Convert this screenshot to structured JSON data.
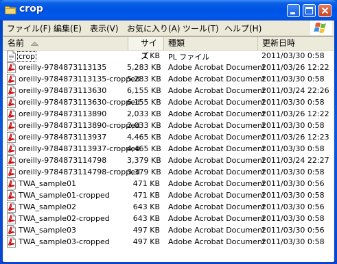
{
  "window": {
    "title": "crop"
  },
  "menu": [
    "ファイル(F)",
    "編集(E)",
    "表示(V)",
    "お気に入り(A)",
    "ツール(T)",
    "ヘルプ(H)"
  ],
  "columns": {
    "name": "名前",
    "size": "サイズ",
    "type": "種類",
    "date": "更新日時"
  },
  "files": [
    {
      "name": "crop",
      "size": "1 KB",
      "type": "PL ファイル",
      "date": "2011/03/30 0:58",
      "icon": "pl-file-icon"
    },
    {
      "name": "oreilly-9784873113135",
      "size": "5,283 KB",
      "type": "Adobe Acrobat Document",
      "date": "2011/03/26 12:22",
      "icon": "pdf-icon"
    },
    {
      "name": "oreilly-9784873113135-cropped",
      "size": "5,283 KB",
      "type": "Adobe Acrobat Document",
      "date": "2011/03/30 0:58",
      "icon": "pdf-icon"
    },
    {
      "name": "oreilly-9784873113630",
      "size": "6,155 KB",
      "type": "Adobe Acrobat Document",
      "date": "2011/03/24 22:26",
      "icon": "pdf-icon"
    },
    {
      "name": "oreilly-9784873113630-cropped",
      "size": "6,155 KB",
      "type": "Adobe Acrobat Document",
      "date": "2011/03/30 0:58",
      "icon": "pdf-icon"
    },
    {
      "name": "oreilly-9784873113890",
      "size": "2,033 KB",
      "type": "Adobe Acrobat Document",
      "date": "2011/03/26 12:22",
      "icon": "pdf-icon"
    },
    {
      "name": "oreilly-9784873113890-cropped",
      "size": "2,033 KB",
      "type": "Adobe Acrobat Document",
      "date": "2011/03/30 0:58",
      "icon": "pdf-icon"
    },
    {
      "name": "oreilly-9784873113937",
      "size": "4,465 KB",
      "type": "Adobe Acrobat Document",
      "date": "2011/03/26 12:23",
      "icon": "pdf-icon"
    },
    {
      "name": "oreilly-9784873113937-cropped",
      "size": "4,465 KB",
      "type": "Adobe Acrobat Document",
      "date": "2011/03/30 0:58",
      "icon": "pdf-icon"
    },
    {
      "name": "oreilly-9784873114798",
      "size": "3,379 KB",
      "type": "Adobe Acrobat Document",
      "date": "2011/03/24 22:27",
      "icon": "pdf-icon"
    },
    {
      "name": "oreilly-9784873114798-cropped",
      "size": "3,379 KB",
      "type": "Adobe Acrobat Document",
      "date": "2011/03/30 0:58",
      "icon": "pdf-icon"
    },
    {
      "name": "TWA_sample01",
      "size": "471 KB",
      "type": "Adobe Acrobat Document",
      "date": "2011/03/30 0:56",
      "icon": "pdf-icon"
    },
    {
      "name": "TWA_sample01-cropped",
      "size": "471 KB",
      "type": "Adobe Acrobat Document",
      "date": "2011/03/30 0:58",
      "icon": "pdf-icon"
    },
    {
      "name": "TWA_sample02",
      "size": "643 KB",
      "type": "Adobe Acrobat Document",
      "date": "2011/03/30 0:56",
      "icon": "pdf-icon"
    },
    {
      "name": "TWA_sample02-cropped",
      "size": "643 KB",
      "type": "Adobe Acrobat Document",
      "date": "2011/03/30 0:58",
      "icon": "pdf-icon"
    },
    {
      "name": "TWA_sample03",
      "size": "497 KB",
      "type": "Adobe Acrobat Document",
      "date": "2011/03/30 0:56",
      "icon": "pdf-icon"
    },
    {
      "name": "TWA_sample03-cropped",
      "size": "497 KB",
      "type": "Adobe Acrobat Document",
      "date": "2011/03/30 0:58",
      "icon": "pdf-icon"
    }
  ],
  "colors": {
    "titlebar": "#0054e3",
    "client": "#ece9d8",
    "pdf_red": "#cc1010"
  }
}
